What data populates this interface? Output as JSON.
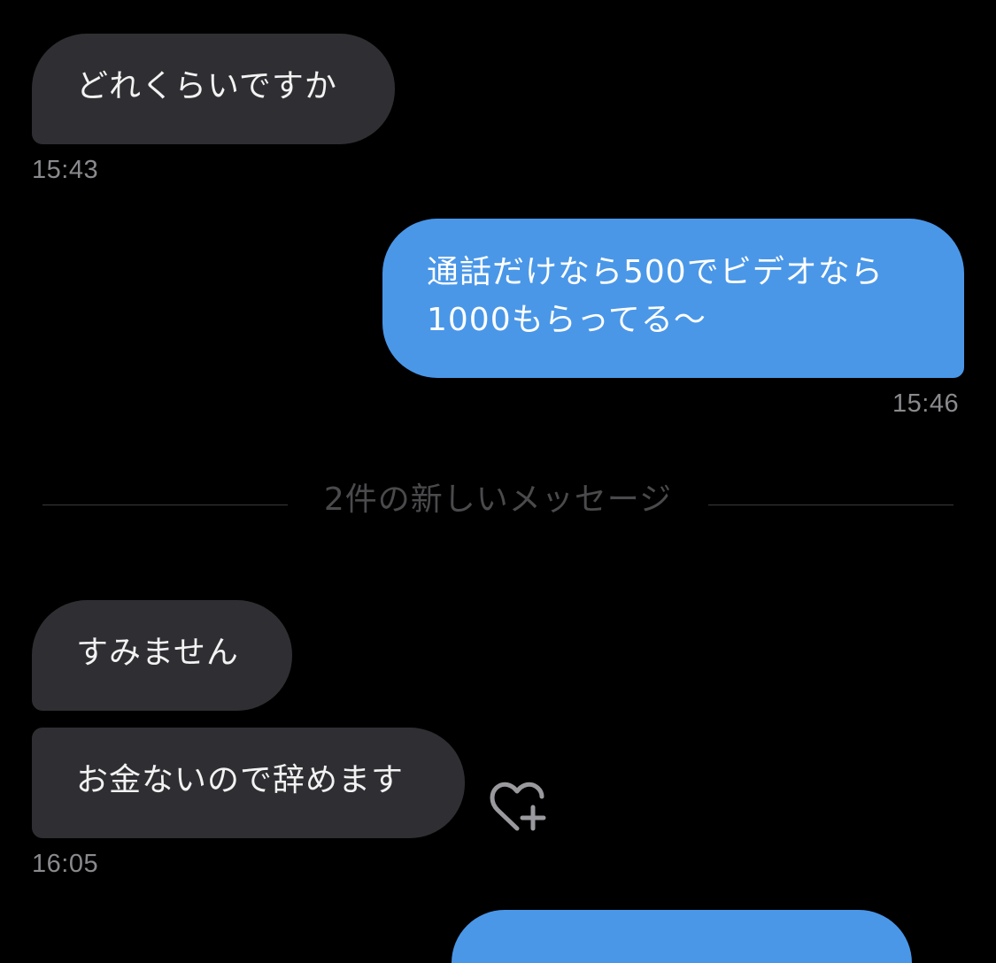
{
  "messages": [
    {
      "direction": "received",
      "text": "どれくらいですか"
    },
    {
      "direction": "sent",
      "lines": [
        "通話だけなら500でビデオなら",
        "1000もらってる〜"
      ]
    },
    {
      "direction": "received",
      "text": "すみません"
    },
    {
      "direction": "received",
      "text": "お金ないので辞めます"
    }
  ],
  "timestamps": {
    "t1": "15:43",
    "t2": "15:46",
    "t3": "16:05"
  },
  "divider": {
    "label": "2件の新しいメッセージ"
  },
  "reaction": {
    "icon": "heart-plus-icon"
  },
  "colors": {
    "background": "#000000",
    "received_bubble": "#2f2f33",
    "sent_bubble": "#4a97e8",
    "timestamp": "#8a8a8e",
    "divider_text": "#4a4a4d"
  }
}
